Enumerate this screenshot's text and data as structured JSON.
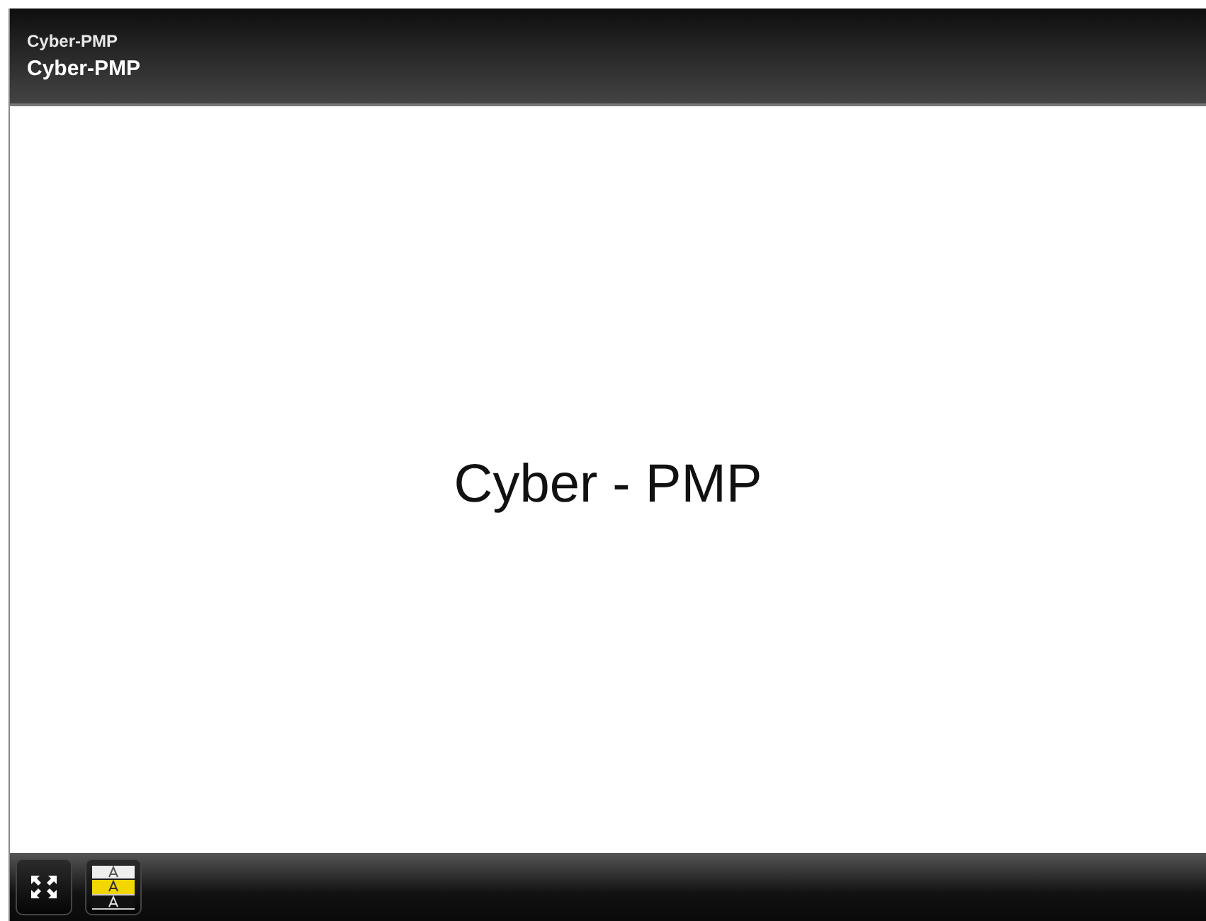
{
  "header": {
    "subtitle": "Cyber-PMP",
    "title": "Cyber-PMP"
  },
  "slide": {
    "text": "Cyber - PMP"
  },
  "toolbar": {
    "buttons": [
      {
        "kind": "fullscreen"
      },
      {
        "kind": "captions"
      }
    ]
  }
}
